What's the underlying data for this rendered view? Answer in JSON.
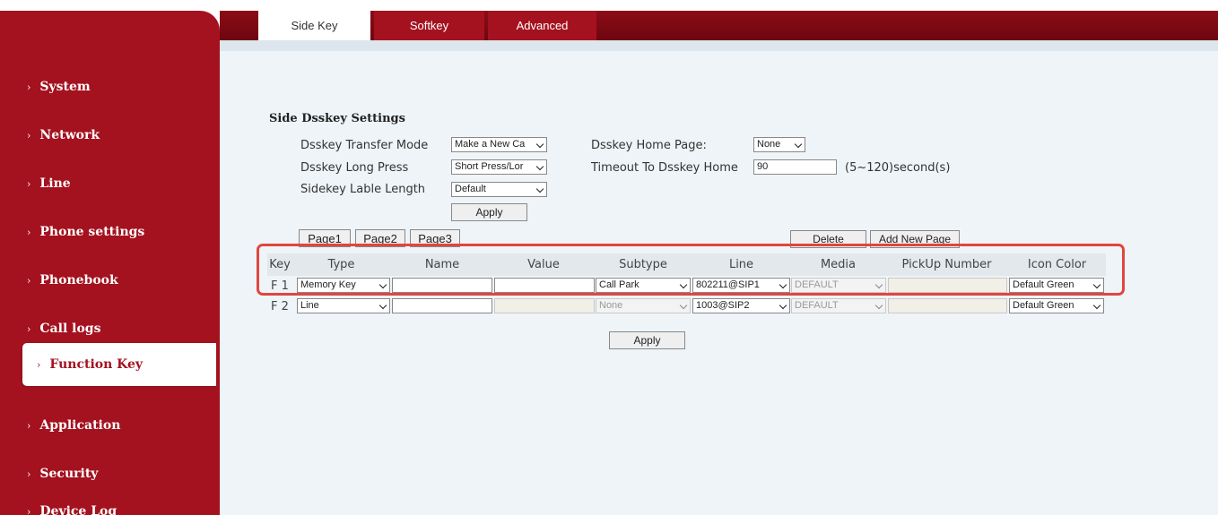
{
  "nav": [
    {
      "label": "System"
    },
    {
      "label": "Network"
    },
    {
      "label": "Line"
    },
    {
      "label": "Phone settings"
    },
    {
      "label": "Phonebook"
    },
    {
      "label": "Call logs"
    },
    {
      "label": "Function Key"
    },
    {
      "label": "Application"
    },
    {
      "label": "Security"
    },
    {
      "label": "Device Log"
    }
  ],
  "tabs": [
    {
      "label": "Side Key"
    },
    {
      "label": "Softkey"
    },
    {
      "label": "Advanced"
    }
  ],
  "section": {
    "title": "Side Dsskey Settings"
  },
  "settings": {
    "transfer_mode": {
      "label": "Dsskey Transfer Mode",
      "value": "Make a New Ca"
    },
    "long_press": {
      "label": "Dsskey Long Press",
      "value": "Short Press/Lor"
    },
    "lable_length": {
      "label": "Sidekey Lable Length",
      "value": "Default"
    },
    "home_page": {
      "label": "Dsskey Home Page:",
      "value": "None"
    },
    "timeout": {
      "label": "Timeout To Dsskey Home",
      "value": "90",
      "hint": "(5~120)second(s)"
    },
    "apply_label": "Apply"
  },
  "pages": {
    "buttons": [
      "Page1",
      "Page2",
      "Page3"
    ],
    "delete_label": "Delete",
    "add_label": "Add New Page"
  },
  "table": {
    "headers": [
      "Key",
      "Type",
      "Name",
      "Value",
      "Subtype",
      "Line",
      "Media",
      "PickUp Number",
      "Icon Color"
    ],
    "rows": [
      {
        "key": "F 1",
        "type": "Memory Key",
        "name": "",
        "value": "",
        "subtype": "Call Park",
        "line": "802211@SIP1",
        "media": "DEFAULT",
        "pickup": "",
        "icon_color": "Default Green"
      },
      {
        "key": "F 2",
        "type": "Line",
        "name": "",
        "value": "",
        "subtype": "None",
        "line": "1003@SIP2",
        "media": "DEFAULT",
        "pickup": "",
        "icon_color": "Default Green"
      }
    ],
    "apply_label": "Apply"
  },
  "colors": {
    "brand": "#a4121f",
    "highlight": "#e0463f"
  }
}
